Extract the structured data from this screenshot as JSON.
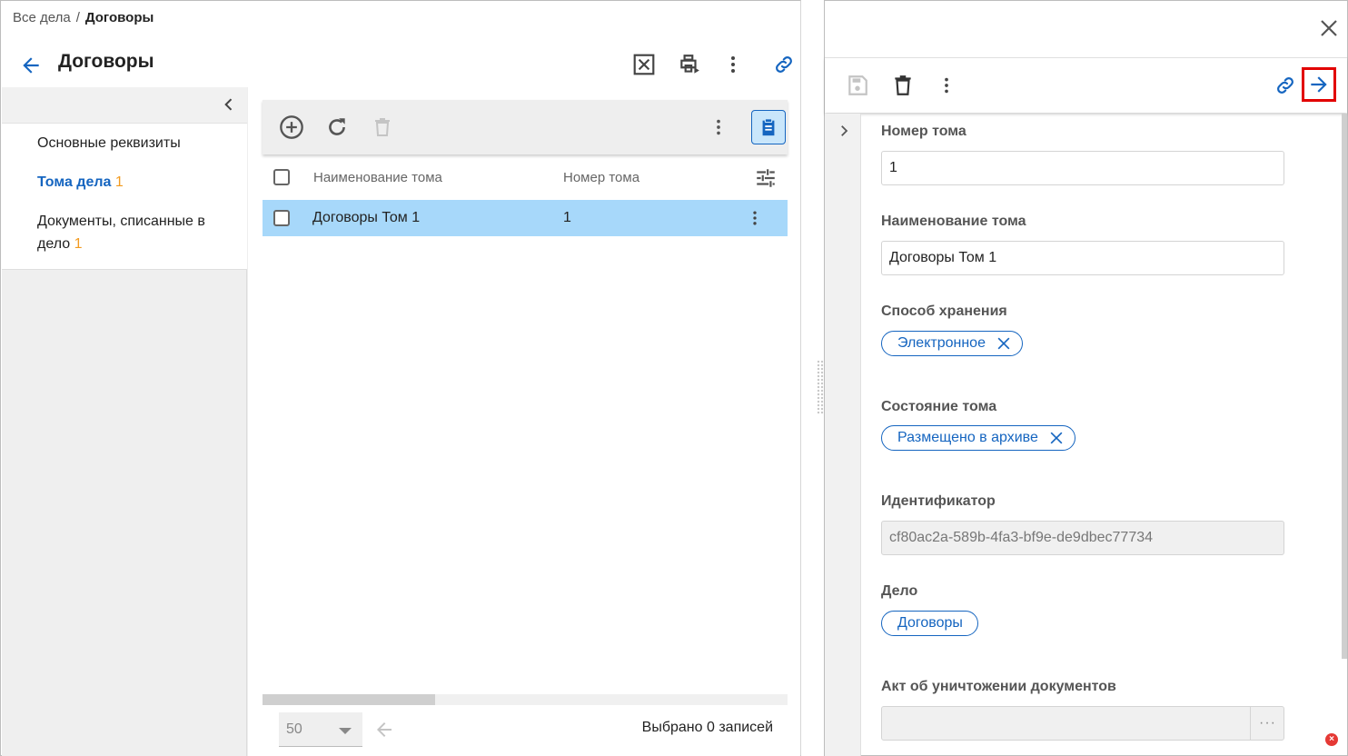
{
  "breadcrumb": {
    "root": "Все дела",
    "separator": "/",
    "current": "Договоры"
  },
  "page": {
    "title": "Договоры"
  },
  "toolbar_icons": [
    "excel-export-icon",
    "print-icon",
    "more-vert-icon",
    "link-icon"
  ],
  "nav": {
    "items": [
      {
        "label": "Основные реквизиты",
        "count": ""
      },
      {
        "label": "Тома дела",
        "count": "1",
        "active": true
      },
      {
        "label": "Документы, списанные в дело",
        "count": "1"
      }
    ]
  },
  "grid": {
    "toolbar_icons": [
      "add-icon",
      "refresh-icon",
      "delete-icon",
      "more-vert-icon",
      "clipboard-icon"
    ],
    "columns": [
      "Наименование тома",
      "Номер тома"
    ],
    "rows": [
      {
        "name": "Договоры Том 1",
        "number": "1",
        "selected": true
      }
    ],
    "page_size": "50",
    "selected_text": "Выбрано 0 записей"
  },
  "detail": {
    "fields": {
      "volume_number": {
        "label": "Номер тома",
        "value": "1"
      },
      "volume_name": {
        "label": "Наименование тома",
        "value": "Договоры Том 1"
      },
      "storage_method": {
        "label": "Способ хранения",
        "chip": "Электронное"
      },
      "volume_state": {
        "label": "Состояние тома",
        "chip": "Размещено в архиве"
      },
      "identifier": {
        "label": "Идентификатор",
        "value": "cf80ac2a-589b-4fa3-bf9e-de9dbec77734"
      },
      "case": {
        "label": "Дело",
        "chip": "Договоры"
      },
      "destruction_act": {
        "label": "Акт об уничтожении документов",
        "value": "",
        "button": "···"
      }
    }
  },
  "colors": {
    "accent": "#1565c0",
    "count": "#f29a1f",
    "selected_row": "#a7d8fa",
    "highlight": "#e20000"
  }
}
